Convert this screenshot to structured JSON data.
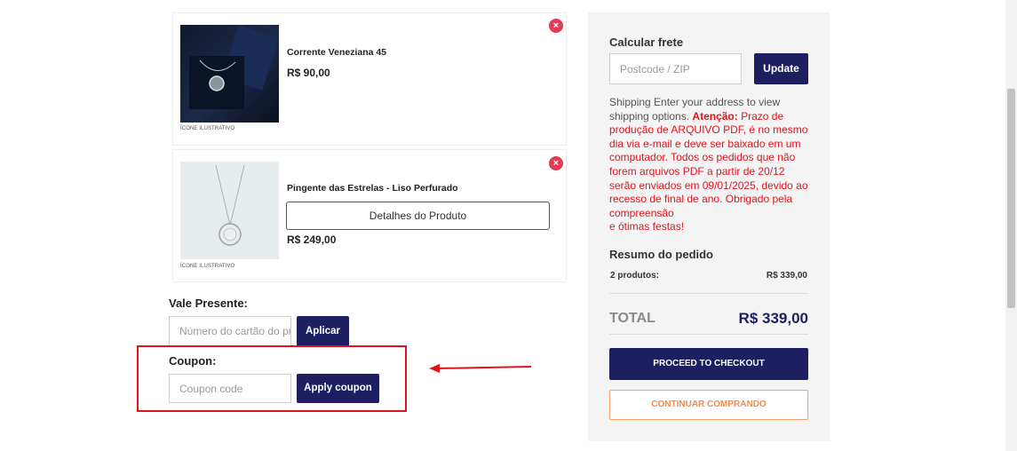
{
  "cart": {
    "items": [
      {
        "name": "Corrente Veneziana 45",
        "price": "R$ 90,00",
        "caption": "ÍCONE ILUSTRATIVO",
        "remove_icon": "×"
      },
      {
        "name": "Pingente das Estrelas - Liso Perfurado",
        "price": "R$ 249,00",
        "caption": "ÍCONE ILUSTRATIVO",
        "details_label": "Detalhes do Produto",
        "remove_icon": "×"
      }
    ]
  },
  "gift": {
    "label": "Vale Presente:",
    "placeholder": "Número do cartão do presente",
    "button": "Aplicar"
  },
  "coupon": {
    "label": "Coupon:",
    "placeholder": "Coupon code",
    "button": "Apply coupon"
  },
  "shipping": {
    "title": "Calcular frete",
    "postcode_placeholder": "Postcode / ZIP",
    "update_button": "Update",
    "info": "Shipping Enter your address to view shipping options.",
    "warning_label": "Atenção:",
    "warning_text": "Prazo de produção de ARQUIVO PDF, é no mesmo dia via e-mail e deve ser baixado em um computador. Todos os pedidos que não forem arquivos PDF a partir de 20/12 serão enviados em 09/01/2025, devido ao recesso de final de ano. Obrigado pela compreensão",
    "warning_text_2": "e ótimas festas!"
  },
  "summary": {
    "title": "Resumo do pedido",
    "products_label": "2 produtos:",
    "products_value": "R$ 339,00",
    "total_label": "TOTAL",
    "total_value": "R$ 339,00",
    "checkout_button": "PROCEED TO CHECKOUT",
    "continue_button": "CONTINUAR COMPRANDO"
  },
  "colors": {
    "navy": "#1c2060",
    "remove_red": "#e23b55",
    "warning_red": "#e3121a",
    "annotation_red": "#e3121a",
    "orange": "#f08a4b"
  }
}
